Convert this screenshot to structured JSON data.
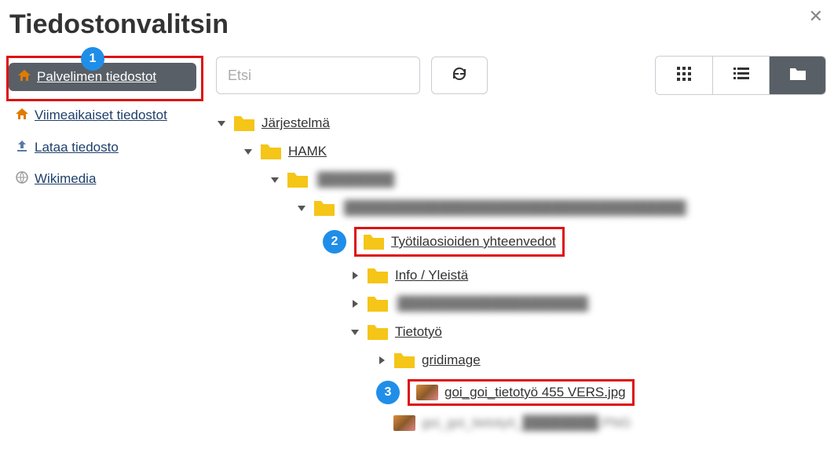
{
  "dialog": {
    "title": "Tiedostonvalitsin"
  },
  "search": {
    "placeholder": "Etsi"
  },
  "badges": {
    "one": "1",
    "two": "2",
    "three": "3"
  },
  "sidebar": {
    "items": [
      {
        "label": "Palvelimen tiedostot"
      },
      {
        "label": "Viimeaikaiset tiedostot"
      },
      {
        "label": "Lataa tiedosto"
      },
      {
        "label": "Wikimedia"
      }
    ]
  },
  "tree": {
    "root": {
      "label": "Järjestelmä"
    },
    "l1": {
      "label": "HAMK"
    },
    "l2": {
      "label": "████████"
    },
    "l3": {
      "label": "████████████████████████████████████"
    },
    "l4": {
      "label": "Työtilaosioiden yhteenvedot"
    },
    "l5a": {
      "label": "Info / Yleistä"
    },
    "l5b": {
      "label": "████████████████████"
    },
    "l5c": {
      "label": "Tietotyö"
    },
    "l6a": {
      "label": "gridimage"
    },
    "f1": {
      "label": "goi_goi_tietotyö 455 VERS.jpg"
    },
    "f2": {
      "label": "goi_goi_tietotyö_████████.PNG"
    }
  }
}
